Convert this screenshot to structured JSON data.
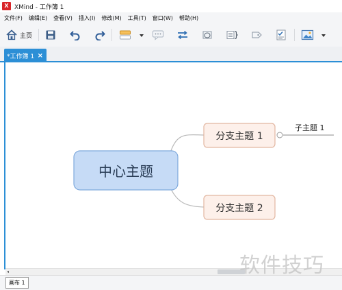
{
  "window": {
    "title": "XMind - 工作簿 1",
    "icon": "xmind-logo-icon",
    "logo_text": "X"
  },
  "menubar": {
    "items": [
      "文件(F)",
      "编辑(E)",
      "查看(V)",
      "插入(I)",
      "修改(M)",
      "工具(T)",
      "窗口(W)",
      "帮助(H)"
    ]
  },
  "toolbar": {
    "home_label": "主页",
    "icons": [
      "home-icon",
      "save-icon",
      "undo-icon",
      "redo-icon",
      "style-brush-icon",
      "callout-icon",
      "relationship-icon",
      "boundary-icon",
      "summary-icon",
      "label-icon",
      "task-icon",
      "insert-image-icon"
    ]
  },
  "editor_tab": {
    "label": "*工作簿 1",
    "close": "×"
  },
  "mindmap": {
    "central_topic": "中心主题",
    "branches": [
      "分支主题 1",
      "分支主题 2"
    ],
    "subtopic": "子主题 1"
  },
  "sheet_tabs": [
    "画布 1"
  ],
  "watermark": "软件技巧",
  "colors": {
    "accent": "#2c8fd6",
    "central_fill": "#c6dbf6",
    "central_border": "#7ea9dc",
    "branch_fill": "#fdf0ea",
    "branch_border": "#e2b6a0",
    "connector": "#b9b9b9"
  }
}
